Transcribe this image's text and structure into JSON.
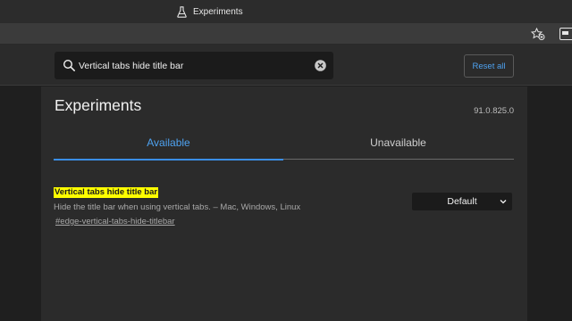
{
  "window": {
    "tab_title": "Experiments"
  },
  "search": {
    "value": "Vertical tabs hide title bar"
  },
  "header": {
    "reset_label": "Reset all"
  },
  "page": {
    "title": "Experiments",
    "version": "91.0.825.0"
  },
  "tabs": [
    {
      "label": "Available",
      "selected": true
    },
    {
      "label": "Unavailable",
      "selected": false
    }
  ],
  "experiment": {
    "name": "Vertical tabs hide title bar",
    "description": "Hide the title bar when using vertical tabs. – Mac, Windows, Linux",
    "link": "#edge-vertical-tabs-hide-titlebar",
    "selected_option": "Default"
  },
  "colors": {
    "accent": "#4ea2f0",
    "highlight": "#ffff00",
    "background": "#2b2b2b"
  },
  "icons": {
    "tab": "flask-icon",
    "favorites": "add-favorite-icon",
    "search": "search-icon",
    "clear": "clear-icon",
    "dropdown": "chevron-down-icon"
  }
}
